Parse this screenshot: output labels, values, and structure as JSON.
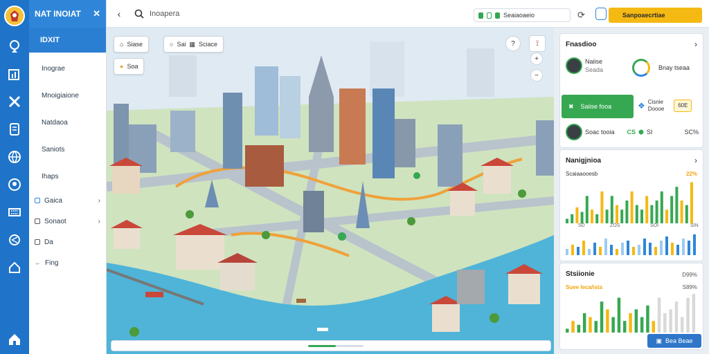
{
  "app": {
    "brand": "NAT INOIAT",
    "brand_sub": "IDXIT"
  },
  "sidebar": {
    "items": [
      {
        "label": "Inograe"
      },
      {
        "label": "Mnoigiaione"
      },
      {
        "label": "Natdaoa"
      },
      {
        "label": "Saniots"
      },
      {
        "label": "Ihaps"
      }
    ],
    "sub_items": [
      {
        "label": "Gaica"
      },
      {
        "label": "Sonaot"
      },
      {
        "label": "Da"
      },
      {
        "label": "Fing"
      }
    ]
  },
  "topbar": {
    "search_text": "Inoapera",
    "status_text": "Seaiaoaeio",
    "primary_label": "Sanpoaecrtiae"
  },
  "map": {
    "btn1": "Siase",
    "btn2": "Sai",
    "btn2b": "Sciace",
    "btn3": "Soa",
    "tool1": "?"
  },
  "panel": {
    "card1": {
      "title": "Fnasdioo",
      "user_name": "Naiise",
      "user_sub": "Seada",
      "metric_label": "Bnay tseaa",
      "green_label": "Saiise fooa",
      "badge_name": "Cisnie",
      "badge_sub": "Doooe",
      "badge_val": "60E",
      "row3_label": "Soac tooia",
      "row3_a": "CS",
      "row3_b": "SI",
      "row3_c": "SC%"
    },
    "card2": {
      "title": "Nanigjnioa",
      "subtitle": "Scaiaaooesb",
      "value": "22%",
      "axis": [
        "SD",
        "ZOS",
        "SOI",
        "SIN"
      ]
    },
    "card3": {
      "title": "Stsiionie",
      "value": "D99%",
      "subtitle": "Suee Ieca/ista",
      "value2": "S89%"
    },
    "button": "Bea Beae"
  },
  "colors": {
    "accent": "#1f74c9",
    "green": "#36a852",
    "yellow": "#f5b914",
    "blue_bar": "#2f86d9"
  }
}
